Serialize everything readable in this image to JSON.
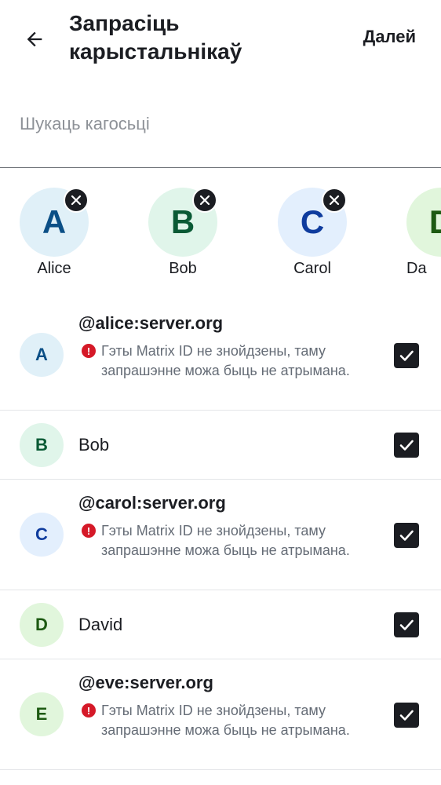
{
  "header": {
    "title": "Запрасіць карыстальнікаў",
    "next_label": "Далей"
  },
  "search": {
    "placeholder": "Шукаць кагосьці"
  },
  "selected_chips": [
    {
      "initial": "A",
      "name": "Alice"
    },
    {
      "initial": "B",
      "name": "Bob"
    },
    {
      "initial": "C",
      "name": "Carol"
    },
    {
      "initial": "D",
      "name": "Da"
    }
  ],
  "users": [
    {
      "initial": "A",
      "name": "@alice:server.org",
      "warning": "Гэты Matrix ID не знойдзены, таму запрашэнне можа быць не атрымана.",
      "checked": true
    },
    {
      "initial": "B",
      "name": "Bob",
      "warning": "",
      "checked": true
    },
    {
      "initial": "C",
      "name": "@carol:server.org",
      "warning": "Гэты Matrix ID не знойдзены, таму запрашэнне можа быць не атрымана.",
      "checked": true
    },
    {
      "initial": "D",
      "name": "David",
      "warning": "",
      "checked": true
    },
    {
      "initial": "E",
      "name": "@eve:server.org",
      "warning": "Гэты Matrix ID не знойдзены, таму запрашэнне можа быць не атрымана.",
      "checked": true
    }
  ],
  "icons": {
    "back": "arrow-left-icon",
    "remove": "close-icon",
    "checkbox": "checkmark-icon",
    "warning": "error-icon"
  },
  "colors": {
    "text": "#1b1d22",
    "warning": "#d51928",
    "secondary_text": "#656c76"
  }
}
